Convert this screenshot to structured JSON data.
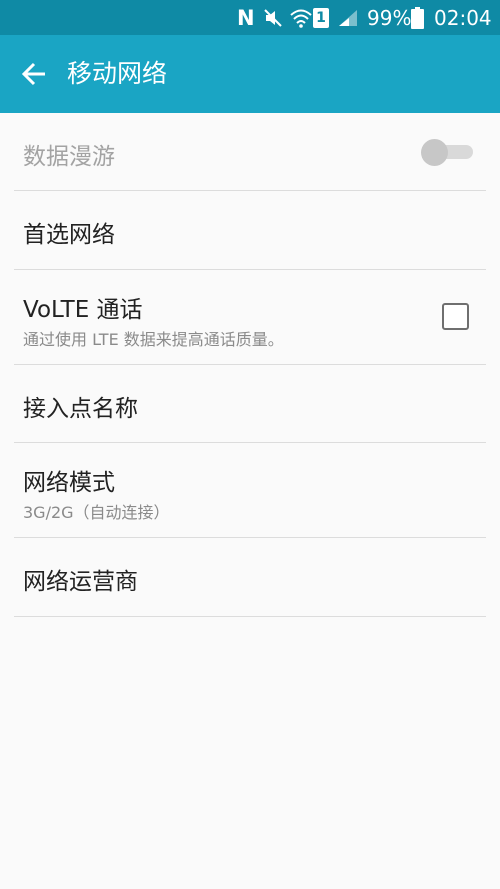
{
  "status_bar": {
    "icons": [
      "nfc-icon",
      "mute-icon",
      "wifi-icon",
      "sim-icon",
      "signal-icon",
      "battery-icon"
    ],
    "nfc_glyph": "N",
    "sim_glyph": "1",
    "battery_level": "99%",
    "time": "02:04"
  },
  "app_bar": {
    "back_icon": "back-arrow-icon",
    "title": "移动网络"
  },
  "settings": {
    "data_roaming": {
      "title": "数据漫游",
      "enabled": false,
      "toggle_on": false
    },
    "preferred_network": {
      "title": "首选网络"
    },
    "volte": {
      "title": "VoLTE 通话",
      "summary": "通过使用 LTE 数据来提高通话质量。",
      "checked": false
    },
    "apn": {
      "title": "接入点名称"
    },
    "network_mode": {
      "title": "网络模式",
      "summary": "3G/2G（自动连接）"
    },
    "network_operators": {
      "title": "网络运营商"
    }
  },
  "colors": {
    "status_bar": "#0f8aa5",
    "app_bar": "#1aa5c4",
    "background": "#fafafa"
  }
}
